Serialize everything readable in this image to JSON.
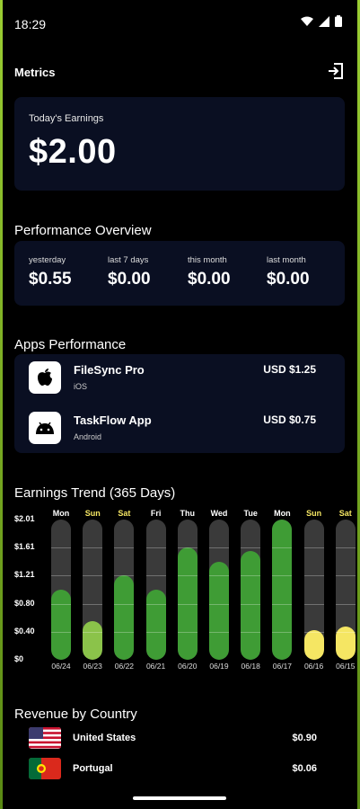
{
  "status": {
    "time": "18:29"
  },
  "header": {
    "title": "Metrics"
  },
  "earnings": {
    "label": "Today's Earnings",
    "value": "$2.00"
  },
  "performance": {
    "title": "Performance Overview",
    "items": [
      {
        "label": "yesterday",
        "value": "$0.55"
      },
      {
        "label": "last 7 days",
        "value": "$0.00"
      },
      {
        "label": "this month",
        "value": "$0.00"
      },
      {
        "label": "last month",
        "value": "$0.00"
      }
    ]
  },
  "apps": {
    "title": "Apps Performance",
    "items": [
      {
        "name": "FileSync Pro",
        "platform": "iOS",
        "amount": "USD $1.25",
        "icon": "apple-icon"
      },
      {
        "name": "TaskFlow App",
        "platform": "Android",
        "amount": "USD $0.75",
        "icon": "android-icon"
      }
    ]
  },
  "trend": {
    "title": "Earnings Trend (365 Days)"
  },
  "chart_data": {
    "type": "bar",
    "title": "Earnings Trend (365 Days)",
    "yticks": [
      "$2.01",
      "$1.61",
      "$1.21",
      "$0.80",
      "$0.40",
      "$0"
    ],
    "ylim": [
      0,
      2.01
    ],
    "categories": [
      "06/24",
      "06/23",
      "06/22",
      "06/21",
      "06/20",
      "06/19",
      "06/18",
      "06/17",
      "06/16",
      "06/15"
    ],
    "days": [
      "Mon",
      "Sun",
      "Sat",
      "Fri",
      "Thu",
      "Wed",
      "Tue",
      "Mon",
      "Sun",
      "Sat"
    ],
    "values": [
      1.0,
      0.55,
      1.21,
      1.0,
      1.61,
      1.4,
      1.56,
      2.01,
      0.42,
      0.48
    ],
    "colors": [
      "#3f9c35",
      "#8bc34a",
      "#3f9c35",
      "#3f9c35",
      "#3f9c35",
      "#3f9c35",
      "#3f9c35",
      "#3f9c35",
      "#f5e663",
      "#f5e663"
    ],
    "day_colors": [
      "#ffffff",
      "#f5e663",
      "#f5e663",
      "#ffffff",
      "#ffffff",
      "#ffffff",
      "#ffffff",
      "#ffffff",
      "#f5e663",
      "#f5e663"
    ]
  },
  "countries": {
    "title": "Revenue by Country",
    "items": [
      {
        "name": "United States",
        "amount": "$0.90",
        "flag": "us-flag-icon"
      },
      {
        "name": "Portugal",
        "amount": "$0.06",
        "flag": "portugal-flag-icon"
      }
    ]
  },
  "colors": {
    "card_bg": "#0a0f22",
    "accent_green": "#3f9c35",
    "accent_yellow": "#f5e663",
    "accent_light_green": "#8bc34a"
  }
}
